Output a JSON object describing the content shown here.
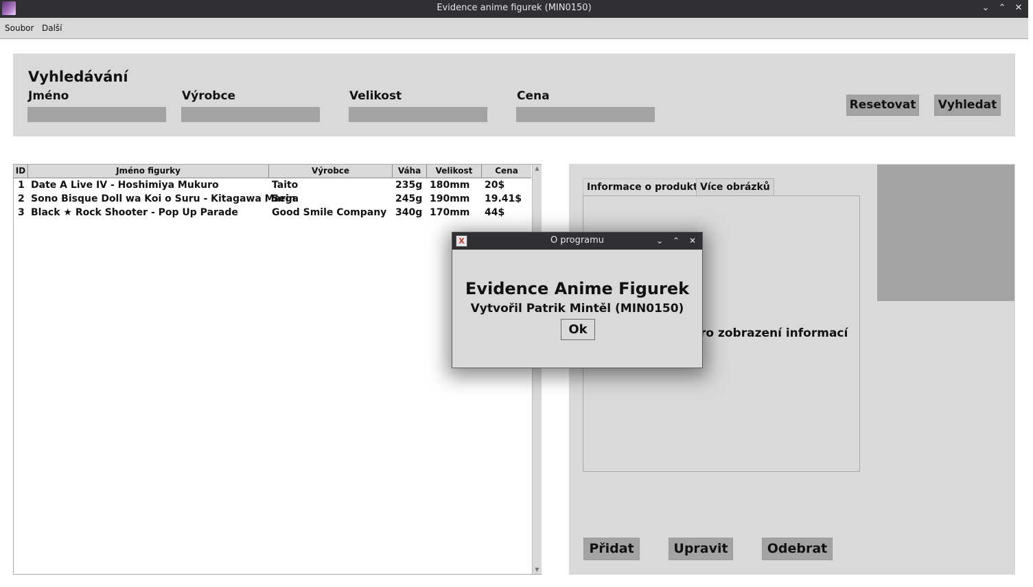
{
  "window": {
    "title": "Evidence anime figurek (MIN0150)",
    "controls": {
      "minimize": "⌄",
      "maximize": "⌃",
      "close": "✕"
    }
  },
  "menu": {
    "items": [
      "Soubor",
      "Další"
    ]
  },
  "search": {
    "title": "Vyhledávání",
    "labels": {
      "name": "Jméno",
      "manufacturer": "Výrobce",
      "size": "Velikost",
      "price": "Cena"
    },
    "values": {
      "name": "",
      "manufacturer": "",
      "size": "",
      "price": ""
    },
    "reset_label": "Resetovat",
    "search_label": "Vyhledat"
  },
  "table": {
    "columns": [
      "ID",
      "Jméno figurky",
      "Výrobce",
      "Váha",
      "Velikost",
      "Cena"
    ],
    "rows": [
      [
        "1",
        "Date A Live IV - Hoshimiya Mukuro",
        "Taito",
        "235g",
        "180mm",
        "20$"
      ],
      [
        "2",
        "Sono Bisque Doll wa Koi o Suru - Kitagawa Marin",
        "Sega",
        "245g",
        "190mm",
        "19.41$"
      ],
      [
        "3",
        "Black ★ Rock Shooter - Pop Up Parade",
        "Good Smile Company",
        "340g",
        "170mm",
        "44$"
      ]
    ]
  },
  "detail": {
    "tabs": [
      "Informace o produktu",
      "Více obrázků"
    ],
    "placeholder_text": "ro zobrazení informací",
    "actions": {
      "add": "Přidat",
      "edit": "Upravit",
      "remove": "Odebrat"
    }
  },
  "dialog": {
    "title": "O programu",
    "heading": "Evidence Anime Figurek",
    "subtitle": "Vytvořil Patrik Mintěl (MIN0150)",
    "ok_label": "Ok",
    "controls": {
      "minimize": "⌄",
      "maximize": "⌃",
      "close": "✕"
    }
  }
}
